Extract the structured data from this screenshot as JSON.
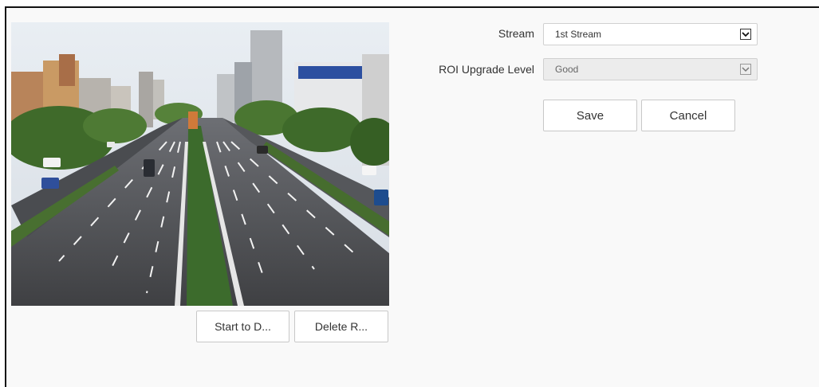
{
  "preview": {
    "start_button_label": "Start to D...",
    "delete_button_label": "Delete R..."
  },
  "form": {
    "stream_label": "Stream",
    "stream_value": "1st Stream",
    "roi_label": "ROI Upgrade Level",
    "roi_value": "Good",
    "save_label": "Save",
    "cancel_label": "Cancel"
  },
  "icons": {
    "stream_dropdown": "chevron-down-icon",
    "roi_dropdown": "chevron-down-icon"
  }
}
